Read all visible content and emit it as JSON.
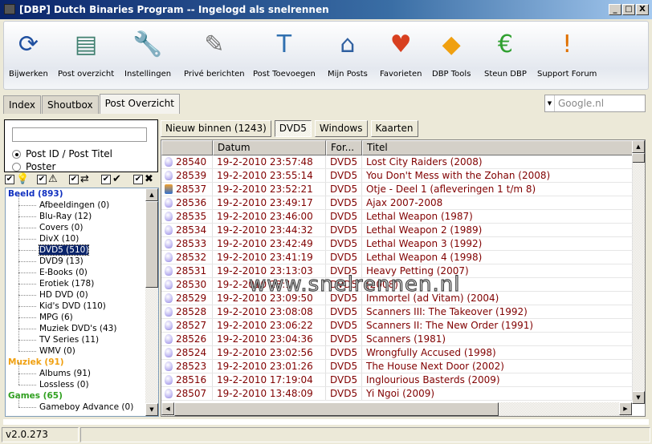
{
  "window": {
    "title": "[DBP] Dutch Binaries Program -- Ingelogd als snelrennen",
    "minimize": "_",
    "maximize": "□",
    "close": "X"
  },
  "toolbar": [
    {
      "label": "Bijwerken",
      "icon": "refresh-icon",
      "glyph": "⟳",
      "color": "#2050a0"
    },
    {
      "label": "Post overzicht",
      "icon": "window-icon",
      "glyph": "▤",
      "color": "#408070"
    },
    {
      "label": "Instellingen",
      "icon": "tools-icon",
      "glyph": "🔧",
      "color": "#555"
    },
    {
      "label": "Privé berichten",
      "icon": "message-edit-icon",
      "glyph": "✎",
      "color": "#777"
    },
    {
      "label": "Post Toevoegen",
      "icon": "text-document-icon",
      "glyph": "T",
      "color": "#3070b0"
    },
    {
      "label": "Mijn Posts",
      "icon": "home-document-icon",
      "glyph": "⌂",
      "color": "#3060a0"
    },
    {
      "label": "Favorieten",
      "icon": "heart-icon",
      "glyph": "♥",
      "color": "#d84020"
    },
    {
      "label": "DBP Tools",
      "icon": "tools-diamond-icon",
      "glyph": "◆",
      "color": "#f0a010"
    },
    {
      "label": "Steun DBP",
      "icon": "euro-icon",
      "glyph": "€",
      "color": "#30a030"
    },
    {
      "label": "Support Forum",
      "icon": "warning-icon",
      "glyph": "!",
      "color": "#e07000"
    }
  ],
  "tabs": [
    {
      "label": "Index"
    },
    {
      "label": "Shoutbox"
    },
    {
      "label": "Post Overzicht",
      "active": true
    }
  ],
  "google": {
    "placeholder": "Google.nl"
  },
  "search": {
    "value": "",
    "options": [
      {
        "label": "Post ID / Post Titel",
        "selected": true
      },
      {
        "label": "Poster",
        "selected": false
      }
    ]
  },
  "filters": [
    {
      "icon": "bulb-icon",
      "glyph": "💡"
    },
    {
      "icon": "warning-icon",
      "glyph": "⚠"
    },
    {
      "icon": "repost-icon",
      "glyph": "⇄"
    },
    {
      "icon": "check-icon",
      "glyph": "✔"
    },
    {
      "icon": "delete-icon",
      "glyph": "✖"
    }
  ],
  "tree": [
    {
      "label": "Beeld (893)",
      "color": "#1030c0",
      "children": [
        "Afbeeldingen (0)",
        "Blu-Ray (12)",
        "Covers (0)",
        "DivX (10)",
        "DVD5 (510)",
        "DVD9 (13)",
        "E-Books (0)",
        "Erotiek (178)",
        "HD DVD (0)",
        "Kid's DVD (110)",
        "MPG (6)",
        "Muziek DVD's (43)",
        "TV Series (11)",
        "WMV (0)"
      ]
    },
    {
      "label": "Muziek (91)",
      "color": "#f0a010",
      "children": [
        "Albums (91)",
        "Lossless (0)"
      ]
    },
    {
      "label": "Games (65)",
      "color": "#30a020",
      "children": [
        "Gameboy Advance (0)"
      ]
    }
  ],
  "tree_selected": "DVD5 (510)",
  "buttons": [
    {
      "label": "Nieuw binnen (1243)"
    },
    {
      "label": "DVD5",
      "active": true
    },
    {
      "label": "Windows"
    },
    {
      "label": "Kaarten"
    }
  ],
  "grid": {
    "columns": [
      "",
      "Datum",
      "For...",
      "Titel"
    ],
    "rows": [
      [
        "28540",
        "19-2-2010 23:57:48",
        "DVD5",
        "Lost City Raiders (2008)"
      ],
      [
        "28539",
        "19-2-2010 23:55:14",
        "DVD5",
        "You Don't Mess with the Zohan (2008)"
      ],
      [
        "28537",
        "19-2-2010 23:52:21",
        "DVD5",
        "Otje - Deel 1 (afleveringen 1 t/m 8)",
        "alt"
      ],
      [
        "28536",
        "19-2-2010 23:49:17",
        "DVD5",
        "Ajax 2007-2008"
      ],
      [
        "28535",
        "19-2-2010 23:46:00",
        "DVD5",
        "Lethal Weapon (1987)"
      ],
      [
        "28534",
        "19-2-2010 23:44:32",
        "DVD5",
        "Lethal Weapon 2 (1989)"
      ],
      [
        "28533",
        "19-2-2010 23:42:49",
        "DVD5",
        "Lethal Weapon 3 (1992)"
      ],
      [
        "28532",
        "19-2-2010 23:41:19",
        "DVD5",
        "Lethal Weapon 4 (1998)"
      ],
      [
        "28531",
        "19-2-2010 23:13:03",
        "DVD5",
        "Heavy Petting (2007)"
      ],
      [
        "28530",
        "19-2-2010 23:1",
        "DVD5",
        "(2008)"
      ],
      [
        "28529",
        "19-2-2010 23:09:50",
        "DVD5",
        "Immortel (ad Vitam) (2004)"
      ],
      [
        "28528",
        "19-2-2010 23:08:08",
        "DVD5",
        "Scanners III: The Takeover (1992)"
      ],
      [
        "28527",
        "19-2-2010 23:06:22",
        "DVD5",
        "Scanners II: The New Order (1991)"
      ],
      [
        "28526",
        "19-2-2010 23:04:36",
        "DVD5",
        "Scanners (1981)"
      ],
      [
        "28524",
        "19-2-2010 23:02:56",
        "DVD5",
        "Wrongfully Accused (1998)"
      ],
      [
        "28523",
        "19-2-2010 23:01:26",
        "DVD5",
        "The House Next Door (2002)"
      ],
      [
        "28516",
        "19-2-2010 17:19:04",
        "DVD5",
        "Inglourious Basterds (2009)"
      ],
      [
        "28507",
        "19-2-2010 13:48:09",
        "DVD5",
        "Yi Ngoi (2009)"
      ]
    ]
  },
  "watermark": "www.snelrennen.nl",
  "status": {
    "version": "v2.0.273"
  }
}
